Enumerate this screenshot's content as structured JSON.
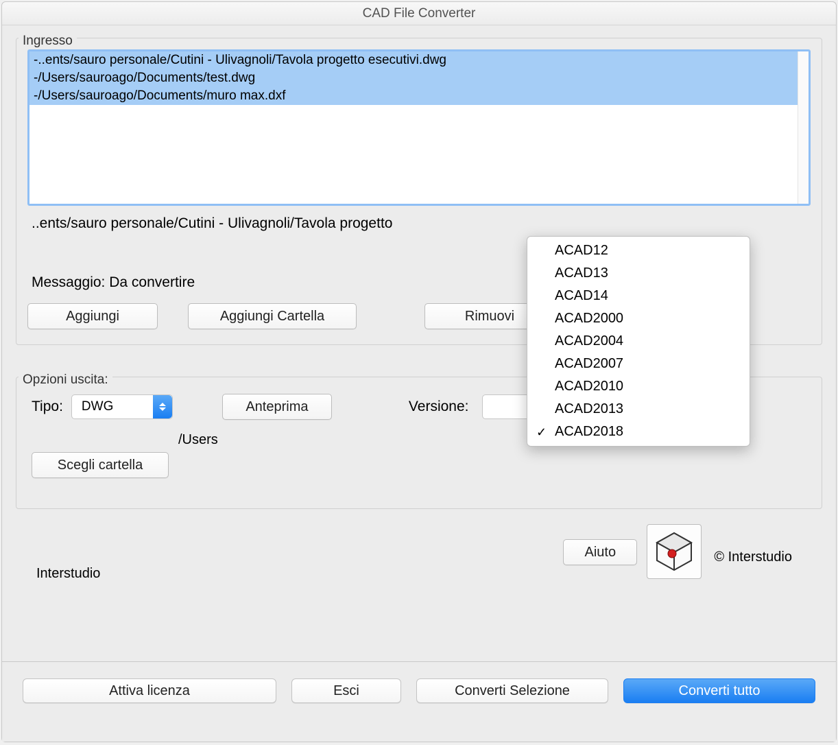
{
  "window": {
    "title": "CAD File Converter"
  },
  "ingresso": {
    "label": "Ingresso",
    "files": [
      "-..ents/sauro personale/Cutini - Ulivagnoli/Tavola progetto esecutivi.dwg",
      "-/Users/sauroago/Documents/test.dwg",
      "-/Users/sauroago/Documents/muro max.dxf"
    ],
    "selected_path": "..ents/sauro personale/Cutini - Ulivagnoli/Tavola progetto",
    "message_label": "Messaggio:",
    "message_value": "Da convertire",
    "buttons": {
      "aggiungi": "Aggiungi",
      "aggiungi_cartella": "Aggiungi Cartella",
      "rimuovi": "Rimuovi"
    }
  },
  "output": {
    "label": "Opzioni uscita:",
    "tipo_label": "Tipo:",
    "tipo_value": "DWG",
    "anteprima": "Anteprima",
    "versione_label": "Versione:",
    "scegli_cartella": "Scegli cartella",
    "folder_path": "/Users",
    "versione_options": [
      "ACAD12",
      "ACAD13",
      "ACAD14",
      "ACAD2000",
      "ACAD2004",
      "ACAD2007",
      "ACAD2010",
      "ACAD2013",
      "ACAD2018"
    ],
    "versione_selected": "ACAD2018"
  },
  "footer": {
    "interstudio": "Interstudio",
    "aiuto": "Aiuto",
    "copyright": "© Interstudio"
  },
  "actions": {
    "attiva_licenza": "Attiva licenza",
    "esci": "Esci",
    "converti_selezione": "Converti Selezione",
    "converti_tutto": "Converti tutto"
  }
}
